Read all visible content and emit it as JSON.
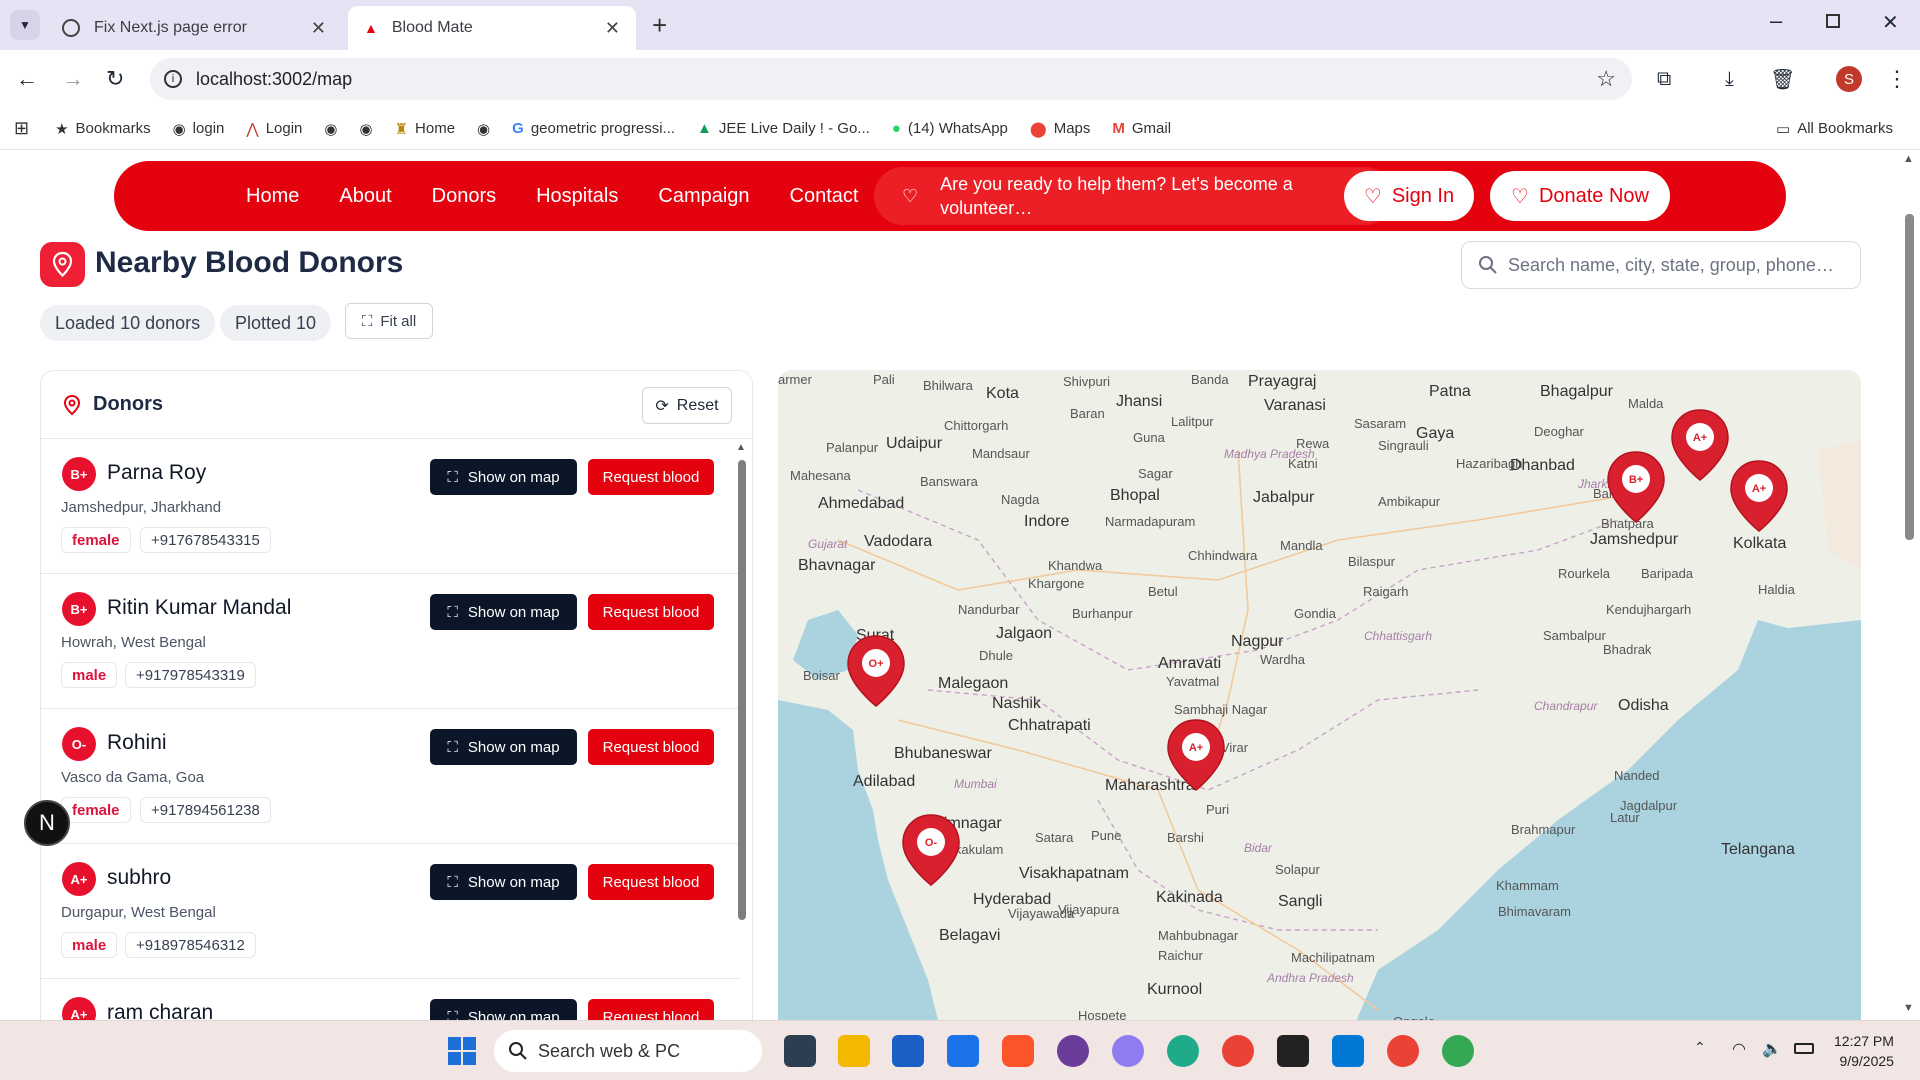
{
  "browser": {
    "tabs": [
      {
        "label": "Fix Next.js page error"
      },
      {
        "label": "Blood Mate"
      }
    ],
    "url": "localhost:3002/map",
    "bookmarks": [
      "Bookmarks",
      "login",
      "Login",
      "Home",
      "geometric progressi...",
      "JEE Live Daily ! - Go...",
      "(14) WhatsApp",
      "Maps",
      "Gmail"
    ],
    "all_bookmarks": "All Bookmarks",
    "profile_letter": "S"
  },
  "nav": {
    "links": [
      "Home",
      "About",
      "Donors",
      "Hospitals",
      "Campaign",
      "Contact"
    ],
    "marquee": "Are you ready to help them? Let's become a volunteer…",
    "sign_in": "Sign In",
    "donate": "Donate Now"
  },
  "header": {
    "title": "Nearby Blood Donors",
    "search_placeholder": "Search name, city, state, group, phone…",
    "loaded": "Loaded 10 donors",
    "plotted": "Plotted 10",
    "fit_all": "Fit all"
  },
  "panel": {
    "title": "Donors",
    "reset": "Reset",
    "show_label": "Show on map",
    "request_label": "Request blood"
  },
  "donors": [
    {
      "group": "B+",
      "name": "Parna Roy",
      "city": "Jamshedpur, Jharkhand",
      "gender": "female",
      "phone": "+917678543315"
    },
    {
      "group": "B+",
      "name": "Ritin Kumar Mandal",
      "city": "Howrah, West Bengal",
      "gender": "male",
      "phone": "+917978543319"
    },
    {
      "group": "O-",
      "name": "Rohini",
      "city": "Vasco da Gama, Goa",
      "gender": "female",
      "phone": "+917894561238"
    },
    {
      "group": "A+",
      "name": "subhro",
      "city": "Durgapur, West Bengal",
      "gender": "male",
      "phone": "+918978546312"
    },
    {
      "group": "A+",
      "name": "ram charan",
      "city": "",
      "gender": "",
      "phone": ""
    }
  ],
  "map": {
    "places": [
      "armer",
      "Pali",
      "Bhilwara",
      "Kota",
      "Shivpuri",
      "Jhansi",
      "Banda",
      "Prayagraj",
      "Patna",
      "Bhagalpur",
      "Malda",
      "Varanasi",
      "Sasaram",
      "Gaya",
      "Deoghar",
      "Udaipur",
      "Chittorgarh",
      "Baran",
      "Lalitpur",
      "Rewa",
      "Singrauli",
      "Palanpur",
      "Mandsaur",
      "Guna",
      "Madhya Pradesh",
      "Katni",
      "Hazaribagh",
      "Mahesana",
      "Banswara",
      "Sagar",
      "Dhanbad",
      "Ahmedabad",
      "Nagda",
      "Bhopal",
      "Jabalpur",
      "Ambikapur",
      "Bankura",
      "Indore",
      "Narmadapuram",
      "Jharkhand",
      "Vadodara",
      "Gujarat",
      "Mandla",
      "Jamshedpur",
      "Kolkata",
      "Bhavnagar",
      "Khandwa",
      "Chhindwara",
      "Bilaspur",
      "Rourkela",
      "Baripada",
      "Haldia",
      "Khargone",
      "Betul",
      "Raigarh",
      "Nandurbar",
      "Burhanpur",
      "Gondia",
      "Kendujhargarh",
      "Surat",
      "Jalgaon",
      "Nagpur",
      "Chhattisgarh",
      "Sambalpur",
      "Dhule",
      "Amravati",
      "Wardha",
      "Bhadrak",
      "Malegaon",
      "Yavatmal",
      "Nashik",
      "Chhatrapati",
      "Sambhaji Nagar",
      "Chandrapur",
      "Odisha",
      "Bhubaneswar",
      "Vasai-Virar",
      "Adilabad",
      "Mumbai",
      "Maharashtra",
      "Nanded",
      "Brahmapur",
      "Jagdalpur",
      "Puri",
      "Karimnagar",
      "Pune",
      "Latur",
      "Srikakulam",
      "Satara",
      "Barshi",
      "Bidar",
      "Telangana",
      "Visakhapatnam",
      "Solapur",
      "Khammam",
      "Hyderabad",
      "Kakinada",
      "Sangli",
      "Vijayawada",
      "Vijayapura",
      "Bhimavaram",
      "Belagavi",
      "Mahbubnagar",
      "Raichur",
      "Machilipatnam",
      "Andhra Pradesh",
      "Kurnool",
      "Hospete",
      "Ongole",
      "Bhatpara",
      "Boisar"
    ],
    "markers": [
      "B+",
      "A+",
      "A+",
      "O+",
      "A+",
      "O-"
    ]
  },
  "taskbar": {
    "search": "Search web & PC",
    "time": "12:27 PM",
    "date": "9/9/2025"
  },
  "fab": "N",
  "colors": {
    "brand_red": "#e4020f",
    "dark_button": "#0b1728",
    "tab_bar": "#e8e3f4",
    "water": "#aad3df",
    "land": "#eef0e8"
  }
}
